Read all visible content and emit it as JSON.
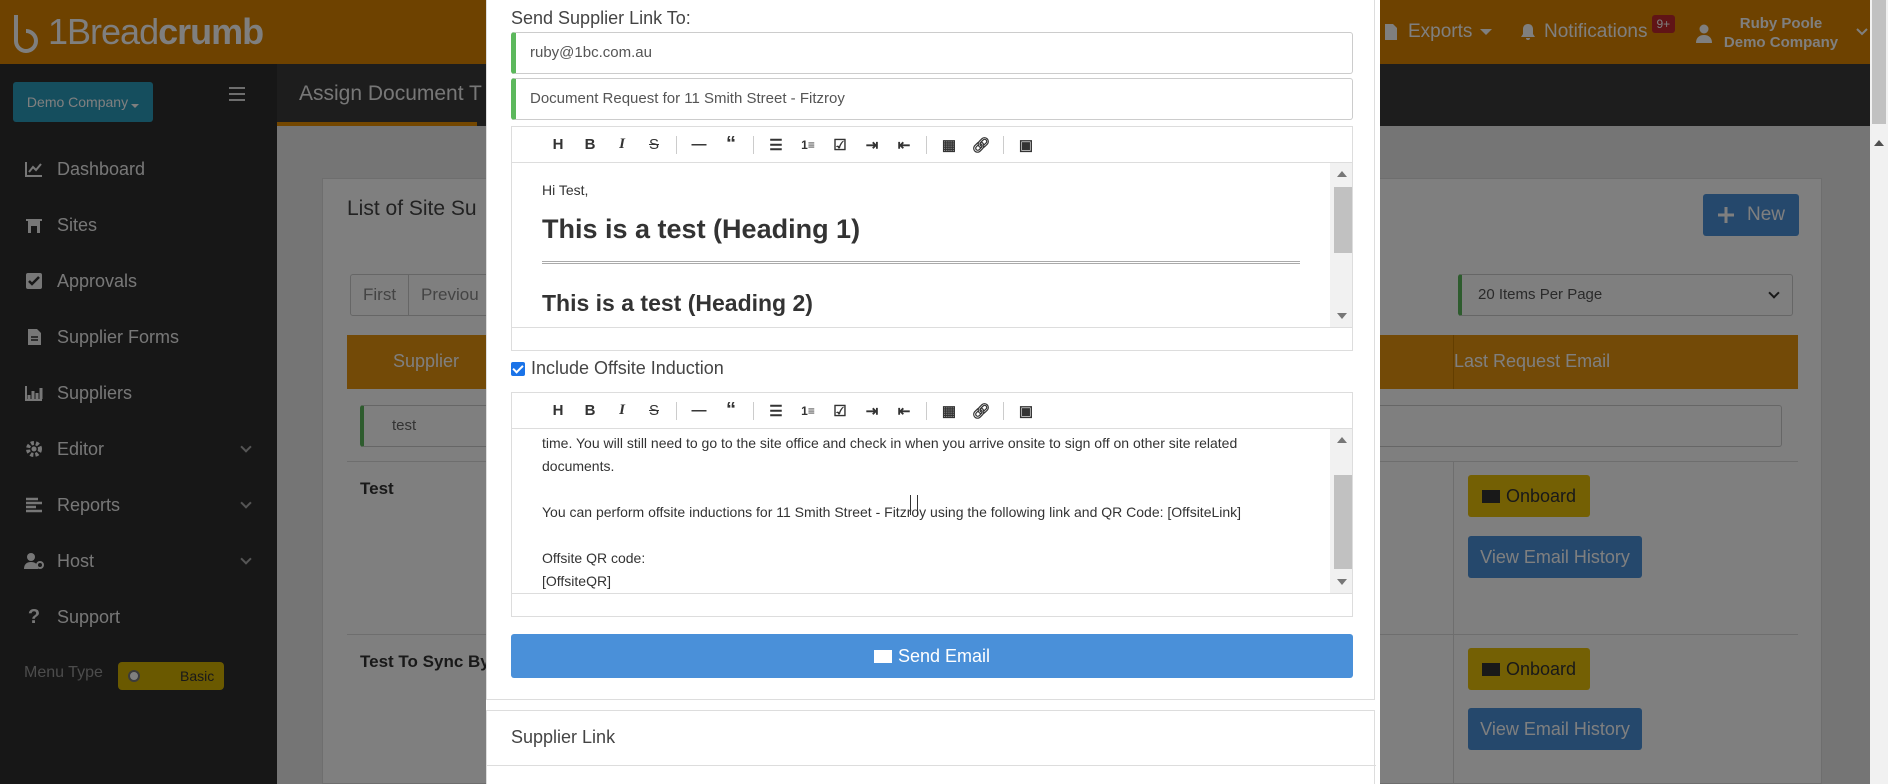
{
  "topbar": {
    "brand_light": "1Bread",
    "brand_bold": "crumb",
    "exports_label": "Exports",
    "notifications_label": "Notifications",
    "notifications_badge": "9+",
    "user_name": "Ruby Poole",
    "user_company": "Demo Company"
  },
  "sidebar": {
    "company_button": "Demo Company",
    "items": [
      {
        "label": "Dashboard",
        "icon": "chart-icon"
      },
      {
        "label": "Sites",
        "icon": "building-icon"
      },
      {
        "label": "Approvals",
        "icon": "checkbox-icon"
      },
      {
        "label": "Supplier Forms",
        "icon": "file-icon"
      },
      {
        "label": "Suppliers",
        "icon": "bar-chart-icon"
      },
      {
        "label": "Editor",
        "icon": "gear-icon"
      },
      {
        "label": "Reports",
        "icon": "list-icon"
      },
      {
        "label": "Host",
        "icon": "user-cog-icon"
      },
      {
        "label": "Support",
        "icon": "question-icon"
      }
    ],
    "menu_type_label": "Menu Type",
    "menu_type_value": "Basic"
  },
  "page": {
    "header_title": "Assign Document T",
    "panel_title": "List of Site Su",
    "new_button": "New",
    "pager_first": "First",
    "pager_previous": "Previou",
    "per_page": "20 Items Per Page",
    "col_supplier": "Supplier",
    "col_last_request": "Last Request Email",
    "filter_value": "test",
    "rows": [
      {
        "name": "Test",
        "onboard": "Onboard",
        "history": "View Email History"
      },
      {
        "name": "Test To Sync By",
        "onboard": "Onboard",
        "history": "View Email History"
      }
    ]
  },
  "modal": {
    "send_to_label": "Send Supplier Link To:",
    "email_value": "ruby@1bc.com.au",
    "subject_value": "Document Request for 11 Smith Street - Fitzroy",
    "editor1": {
      "greeting": "Hi Test,",
      "heading1": "This is a test (Heading 1)",
      "heading2": "This is a test (Heading 2)"
    },
    "include_induction_label": "Include Offsite Induction",
    "include_induction_checked": true,
    "editor2": {
      "line1": "time. You will still need to go to the site office and check in when you arrive onsite to sign off on other site related",
      "line2": "documents.",
      "line3": "You can perform offsite inductions for 11 Smith Street - Fitzroy using the following link and QR Code: [OffsiteLink]",
      "line4": "Offsite QR code:",
      "line5": "[OffsiteQR]"
    },
    "send_button": "Send Email",
    "supplier_link_title": "Supplier Link"
  },
  "colors": {
    "brand_orange": "#dc8400",
    "primary_blue": "#4a90d9",
    "warning_yellow": "#e8c109",
    "success_green": "#5cb85c"
  }
}
